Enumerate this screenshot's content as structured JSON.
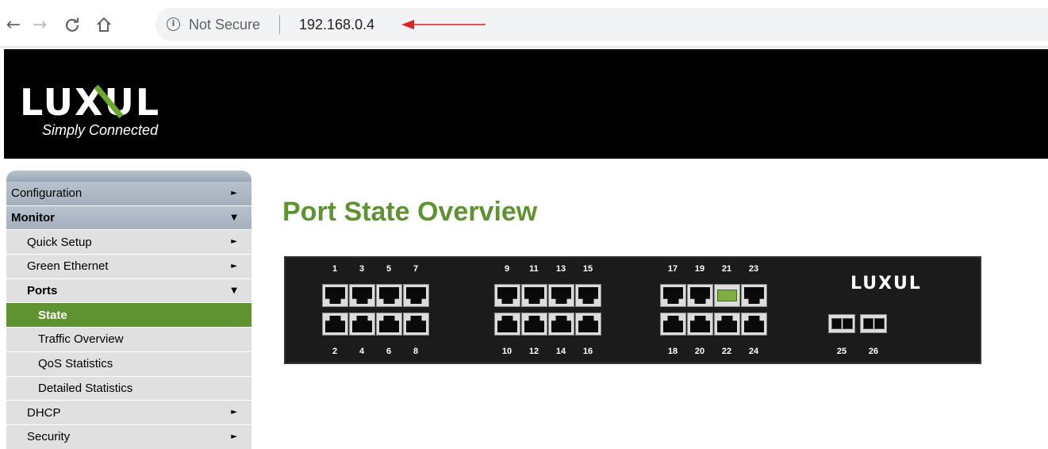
{
  "browser": {
    "back_icon": "←",
    "forward_icon": "→",
    "reload_icon": "C",
    "home_icon": "⌂",
    "info_icon": "i",
    "security_label": "Not Secure",
    "url": "192.168.0.4"
  },
  "header": {
    "logo": "LUXUL",
    "tagline": "Simply Connected"
  },
  "sidebar": {
    "items": [
      {
        "label": "Configuration",
        "arrow": "►"
      },
      {
        "label": "Monitor",
        "arrow": "▼"
      },
      {
        "label": "Quick Setup",
        "arrow": "►"
      },
      {
        "label": "Green Ethernet",
        "arrow": "►"
      },
      {
        "label": "Ports",
        "arrow": "▼"
      },
      {
        "label": "State"
      },
      {
        "label": "Traffic Overview"
      },
      {
        "label": "QoS Statistics"
      },
      {
        "label": "Detailed Statistics"
      },
      {
        "label": "DHCP",
        "arrow": "►"
      },
      {
        "label": "Security",
        "arrow": "►"
      }
    ]
  },
  "main": {
    "title": "Port State Overview"
  },
  "switch": {
    "logo": "LUXUL",
    "top_ports": [
      "1",
      "3",
      "5",
      "7",
      "9",
      "11",
      "13",
      "15",
      "17",
      "19",
      "21",
      "23"
    ],
    "bottom_ports": [
      "2",
      "4",
      "6",
      "8",
      "10",
      "12",
      "14",
      "16",
      "18",
      "20",
      "22",
      "24"
    ],
    "sfp_ports": [
      "25",
      "26"
    ],
    "linked_port": "21",
    "colors": {
      "link": "#7dae3f",
      "accent": "#5f9230"
    }
  }
}
